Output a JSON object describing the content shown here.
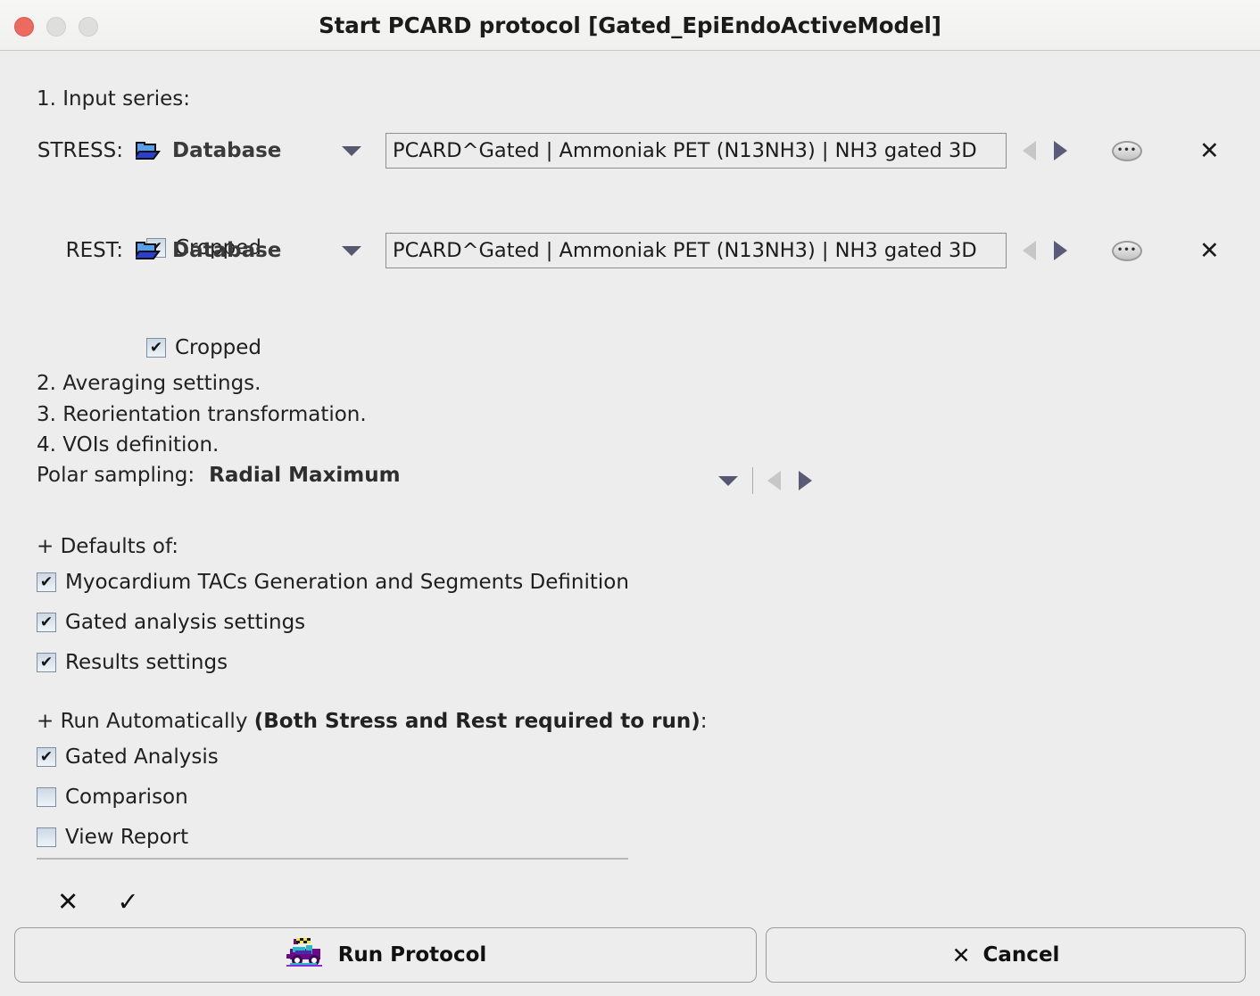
{
  "window": {
    "title": "Start PCARD protocol [Gated_EpiEndoActiveModel]",
    "controls": {
      "close": "close-button",
      "minimize": "minimize-button",
      "maximize": "maximize-button"
    }
  },
  "steps": {
    "step1": "1. Input series:",
    "step2": "2. Averaging settings.",
    "step3": "3. Reorientation transformation.",
    "step4": "4. VOIs definition."
  },
  "series": [
    {
      "label": "STRESS:",
      "source": "Database",
      "value": "PCARD^Gated | Ammoniak PET (N13NH3) | NH3 gated 3D",
      "cropped_label": "Cropped",
      "cropped_checked": true,
      "prev_enabled": false,
      "next_enabled": true,
      "more_label": "•••",
      "clear_label": "✕"
    },
    {
      "label": "REST:",
      "source": "Database",
      "value": "PCARD^Gated | Ammoniak PET (N13NH3) | NH3 gated 3D",
      "cropped_label": "Cropped",
      "cropped_checked": true,
      "prev_enabled": false,
      "next_enabled": true,
      "more_label": "•••",
      "clear_label": "✕"
    }
  ],
  "polar": {
    "label": "Polar sampling:",
    "value": "Radial Maximum"
  },
  "defaults": {
    "header": "+ Defaults of:",
    "items": [
      {
        "label": "Myocardium TACs Generation and Segments Definition",
        "checked": true
      },
      {
        "label": "Gated analysis settings",
        "checked": true
      },
      {
        "label": "Results settings",
        "checked": true
      }
    ]
  },
  "run_auto": {
    "header_plain": "+ Run Automatically ",
    "header_bold": "(Both Stress and Rest required to run)",
    "header_tail": ":",
    "items": [
      {
        "label": "Gated Analysis",
        "checked": true
      },
      {
        "label": "Comparison",
        "checked": false
      },
      {
        "label": "View Report",
        "checked": false
      }
    ]
  },
  "bottom_icons": {
    "uncheck_all": "✕",
    "check_all": "✓"
  },
  "footer": {
    "run_label": "Run Protocol",
    "cancel_label": "Cancel",
    "cancel_icon": "✕"
  },
  "colors": {
    "background": "#ededed",
    "titlebar": "#f5f5f3",
    "close_dot": "#ed6a5e",
    "inactive_dot": "#dededc",
    "accent_arrow": "#5b5b78",
    "disabled_arrow": "#c7c7c7",
    "folder_top": "#56a0f0",
    "folder_bottom": "#2b3fd0",
    "checkbox_fill": "#ccd8e4"
  }
}
